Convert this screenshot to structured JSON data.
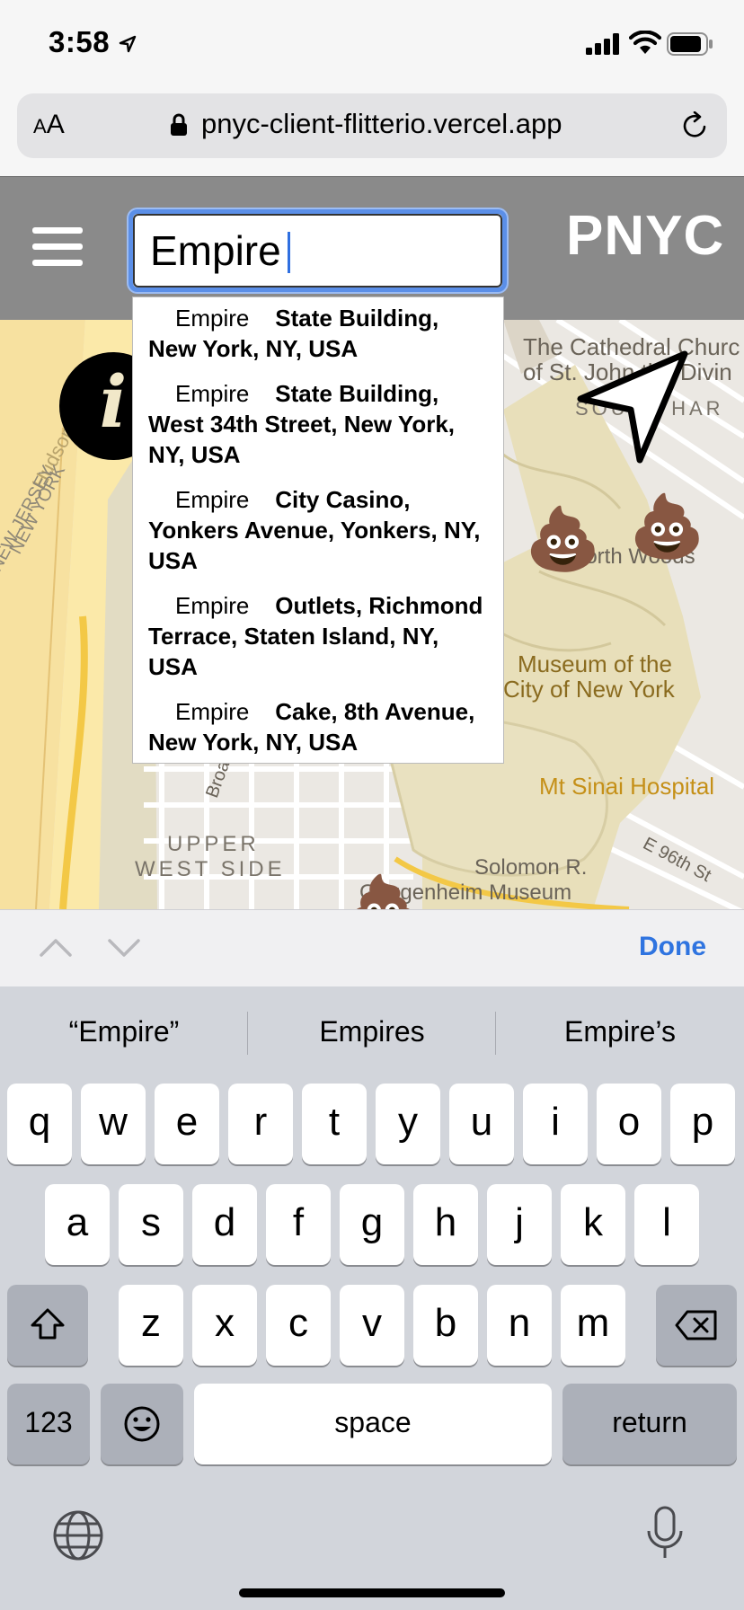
{
  "status_bar": {
    "time": "3:58"
  },
  "browser": {
    "text_size_label_small": "A",
    "text_size_label_large": "A",
    "url": "pnyc-client-flitterio.vercel.app"
  },
  "app": {
    "brand": "PNYC",
    "search": {
      "value": "Empire",
      "placeholder": ""
    },
    "suggestions": [
      {
        "match": "Empire",
        "rest": "State Building, New York, NY, USA"
      },
      {
        "match": "Empire",
        "rest": "State Building, West 34th Street, New York, NY, USA"
      },
      {
        "match": "Empire",
        "rest": "City Casino, Yonkers Avenue, Yonkers, NY, USA"
      },
      {
        "match": "Empire",
        "rest": "Outlets, Richmond Terrace, Staten Island, NY, USA"
      },
      {
        "match": "Empire",
        "rest": "Cake, 8th Avenue, New York, NY, USA"
      }
    ],
    "info_button_glyph": "i",
    "markers": [
      "💩",
      "💩",
      "💩"
    ]
  },
  "map": {
    "labels": {
      "cathedral_1": "The Cathedral Churc",
      "cathedral_2": "of St. John the Divin",
      "south_harlem": "SOUTH HAR",
      "north_woods": "North Woods",
      "museum_1": "Museum of the",
      "museum_2": "City of New York",
      "mt_sinai": "Mt Sinai Hospital",
      "upper_1": "UPPER",
      "upper_2": "WEST SIDE",
      "solomon_1": "Solomon R.",
      "solomon_2": "Guggenheim Museum",
      "e96": "E 96th St",
      "hudson": "Hudson",
      "nj": "NEW JERSEY",
      "ny": "NEW YORK",
      "broadway": "Broa"
    }
  },
  "accessory": {
    "done_label": "Done"
  },
  "keyboard": {
    "predictions": [
      "“Empire”",
      "Empires",
      "Empire’s"
    ],
    "row1": [
      "q",
      "w",
      "e",
      "r",
      "t",
      "y",
      "u",
      "i",
      "o",
      "p"
    ],
    "row2": [
      "a",
      "s",
      "d",
      "f",
      "g",
      "h",
      "j",
      "k",
      "l"
    ],
    "row3": [
      "z",
      "x",
      "c",
      "v",
      "b",
      "n",
      "m"
    ],
    "numbers_label": "123",
    "space_label": "space",
    "return_label": "return"
  }
}
